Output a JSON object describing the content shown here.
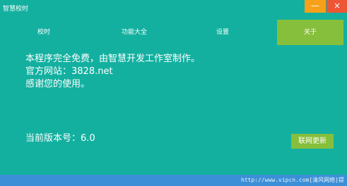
{
  "window": {
    "title": "智慧校时",
    "minimize_label": "—",
    "close_label": "×"
  },
  "tabs": [
    {
      "label": "校时",
      "active": false
    },
    {
      "label": "功能大全",
      "active": false
    },
    {
      "label": "设置",
      "active": false
    },
    {
      "label": "关于",
      "active": true
    }
  ],
  "about": {
    "lines": [
      "本程序完全免费，由智慧开发工作室制作。",
      "官方网站：3828.net",
      "感谢您的使用。"
    ],
    "version_text": "当前版本号：6.0",
    "update_button": "联网更新"
  },
  "statusbar": {
    "watermark": "http://www.vipcn.com[清风网络]提"
  },
  "colors": {
    "background": "#13b0a0",
    "active_tab": "#86bf3b",
    "minimize": "#f6a119",
    "close": "#ee5535",
    "statusbar": "#3b8fd7"
  }
}
